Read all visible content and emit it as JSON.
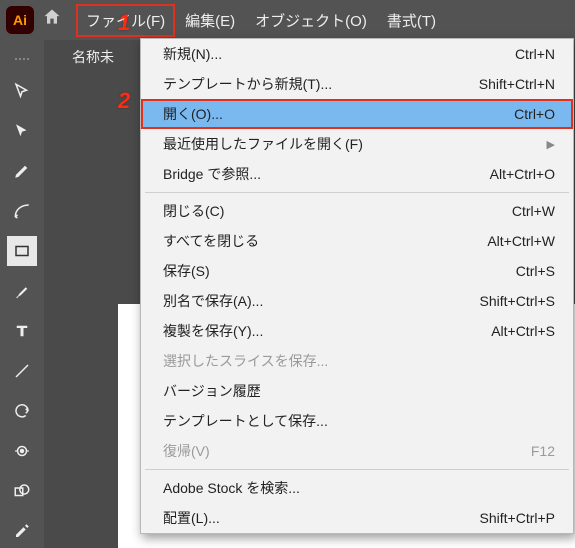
{
  "app": {
    "icon_text": "Ai"
  },
  "menubar": {
    "items": [
      {
        "label": "ファイル(F)"
      },
      {
        "label": "編集(E)"
      },
      {
        "label": "オブジェクト(O)"
      },
      {
        "label": "書式(T)"
      }
    ]
  },
  "tab": {
    "label": "名称未"
  },
  "dropdown": {
    "items": [
      {
        "label": "新規(N)...",
        "shortcut": "Ctrl+N"
      },
      {
        "label": "テンプレートから新規(T)...",
        "shortcut": "Shift+Ctrl+N"
      },
      {
        "label": "開く(O)...",
        "shortcut": "Ctrl+O"
      },
      {
        "label": "最近使用したファイルを開く(F)",
        "shortcut": ""
      },
      {
        "label": "Bridge で参照...",
        "shortcut": "Alt+Ctrl+O"
      },
      {
        "label": "閉じる(C)",
        "shortcut": "Ctrl+W"
      },
      {
        "label": "すべてを閉じる",
        "shortcut": "Alt+Ctrl+W"
      },
      {
        "label": "保存(S)",
        "shortcut": "Ctrl+S"
      },
      {
        "label": "別名で保存(A)...",
        "shortcut": "Shift+Ctrl+S"
      },
      {
        "label": "複製を保存(Y)...",
        "shortcut": "Alt+Ctrl+S"
      },
      {
        "label": "選択したスライスを保存...",
        "shortcut": ""
      },
      {
        "label": "バージョン履歴",
        "shortcut": ""
      },
      {
        "label": "テンプレートとして保存...",
        "shortcut": ""
      },
      {
        "label": "復帰(V)",
        "shortcut": "F12"
      },
      {
        "label": "Adobe Stock を検索...",
        "shortcut": ""
      },
      {
        "label": "配置(L)...",
        "shortcut": "Shift+Ctrl+P"
      }
    ]
  },
  "annotations": {
    "one": "1",
    "two": "2"
  }
}
